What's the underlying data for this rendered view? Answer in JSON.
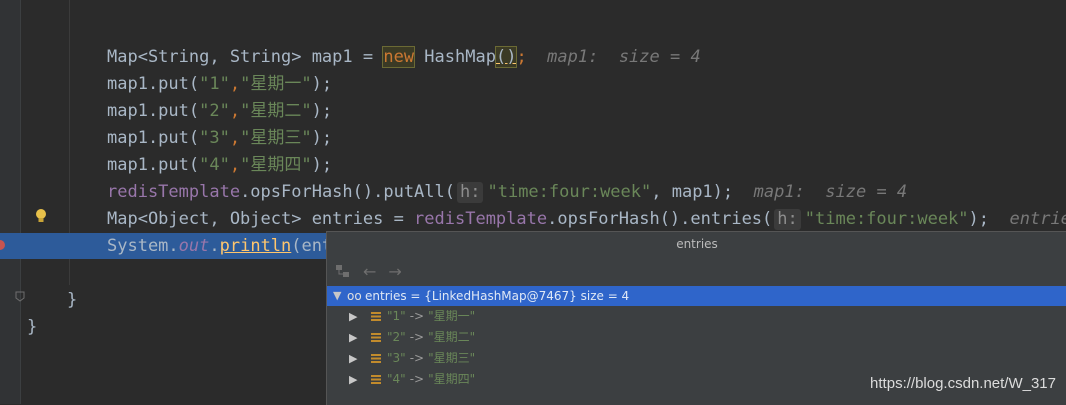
{
  "code": {
    "l1": {
      "a": "Map<String, String> map1 = ",
      "new": "new",
      "b": " HashMap",
      "c": "()",
      "d": ";",
      "hint": "map1:  size = 4"
    },
    "l2": {
      "a": "map1.put(",
      "s1": "\"1\"",
      "comma": ",",
      "s2": "\"星期一\"",
      "end": ");"
    },
    "l3": {
      "a": "map1.put(",
      "s1": "\"2\"",
      "comma": ",",
      "s2": "\"星期二\"",
      "end": ");"
    },
    "l4": {
      "a": "map1.put(",
      "s1": "\"3\"",
      "comma": ",",
      "s2": "\"星期三\"",
      "end": ");"
    },
    "l5": {
      "a": "map1.put(",
      "s1": "\"4\"",
      "comma": ",",
      "s2": "\"星期四\"",
      "end": ");"
    },
    "l6": {
      "f": "redisTemplate",
      "a": ".opsForHash().putAll(",
      "ph": "h:",
      "s": "\"time:four:week\"",
      "b": ", map1);",
      "hint": "map1:  size = 4"
    },
    "l7": {
      "a": "Map<Object, Object> entries = ",
      "f": "redisTemplate",
      "b": ".opsForHash().entries(",
      "ph": "h:",
      "s": "\"time:four:week\"",
      "c": ");",
      "hint": "entries:"
    },
    "l8": {
      "a": "System.",
      "out": "out",
      "dot": ".",
      "fn": "println",
      "b": "(ent"
    },
    "brace_inner": "}",
    "brace_outer": "}"
  },
  "popup": {
    "title": "entries",
    "toolbar": {
      "back": "←",
      "forward": "→"
    },
    "root": "entries = {LinkedHashMap@7467}  size = 4",
    "items": [
      {
        "key": "\"1\"",
        "arrow": "->",
        "val": "\"星期一\""
      },
      {
        "key": "\"2\"",
        "arrow": "->",
        "val": "\"星期二\""
      },
      {
        "key": "\"3\"",
        "arrow": "->",
        "val": "\"星期三\""
      },
      {
        "key": "\"4\"",
        "arrow": "->",
        "val": "\"星期四\""
      }
    ]
  },
  "watermark": "https://blog.csdn.net/W_317",
  "colors": {
    "background": "#2b2b2b",
    "keyword": "#cc7832",
    "string": "#6a8759",
    "selection": "#2d5b9a"
  }
}
